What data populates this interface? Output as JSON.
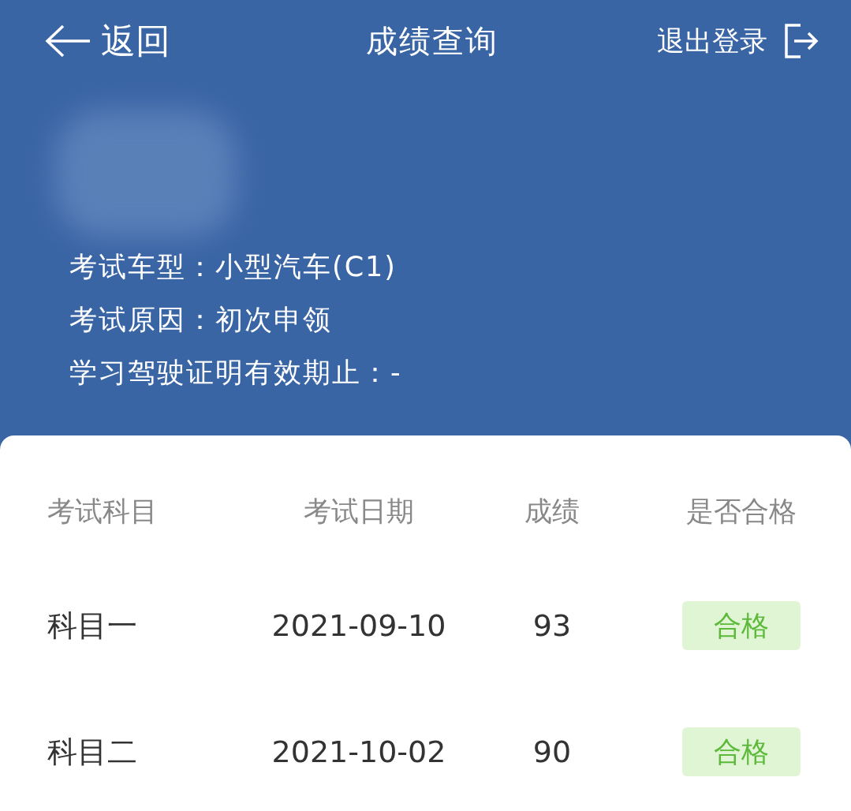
{
  "header": {
    "back_label": "返回",
    "title": "成绩查询",
    "logout_label": "退出登录"
  },
  "info": [
    "考试车型：小型汽车(C1)",
    "考试原因：初次申领",
    "学习驾驶证明有效期止：-"
  ],
  "table": {
    "columns": [
      "考试科目",
      "考试日期",
      "成绩",
      "是否合格"
    ],
    "rows": [
      {
        "subject": "科目一",
        "date": "2021-09-10",
        "score": "93",
        "result": "合格",
        "passed": true
      },
      {
        "subject": "科目二",
        "date": "2021-10-02",
        "score": "90",
        "result": "合格",
        "passed": true
      }
    ]
  }
}
